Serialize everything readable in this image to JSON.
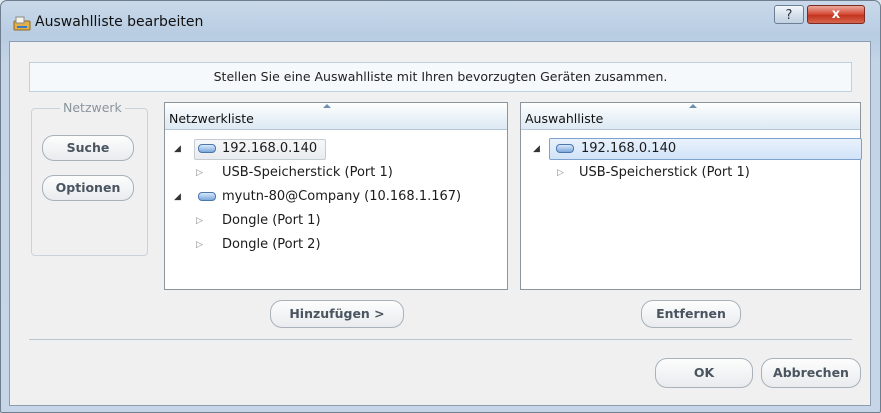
{
  "window": {
    "title": "Auswahlliste bearbeiten",
    "help_label": "?",
    "close_label": "x"
  },
  "banner": "Stellen Sie eine Auswahlliste mit Ihren bevorzugten Geräten zusammen.",
  "network_group": {
    "label": "Netzwerk",
    "search_label": "Suche",
    "options_label": "Optionen"
  },
  "network_list": {
    "header": "Netzwerkliste",
    "items": [
      {
        "label": "192.168.0.140",
        "level": 0,
        "expanded": true,
        "icon": "device-icon",
        "selected": true
      },
      {
        "label": "USB-Speicherstick (Port 1)",
        "level": 1,
        "expanded": false
      },
      {
        "label": "myutn-80@Company (10.168.1.167)",
        "level": 0,
        "expanded": true,
        "icon": "device-icon"
      },
      {
        "label": "Dongle (Port 1)",
        "level": 1,
        "expanded": false
      },
      {
        "label": "Dongle (Port 2)",
        "level": 1,
        "expanded": false
      }
    ],
    "add_label": "Hinzufügen >"
  },
  "selection_list": {
    "header": "Auswahlliste",
    "items": [
      {
        "label": "192.168.0.140",
        "level": 0,
        "expanded": true,
        "icon": "device-icon",
        "selected": true
      },
      {
        "label": "USB-Speicherstick (Port 1)",
        "level": 1,
        "expanded": false
      }
    ],
    "remove_label": "Entfernen"
  },
  "footer": {
    "ok_label": "OK",
    "cancel_label": "Abbrechen"
  }
}
